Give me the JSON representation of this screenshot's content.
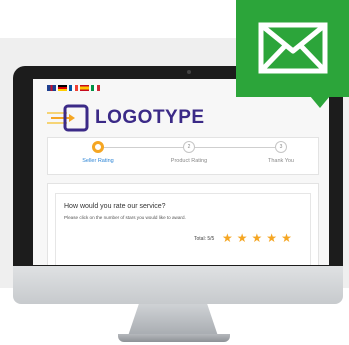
{
  "languages": [
    "en-flag",
    "de-flag",
    "fr-flag",
    "es-flag",
    "it-flag"
  ],
  "logo": {
    "text": "LOGOTYPE"
  },
  "steps": [
    {
      "label": "Seller Rating",
      "number": "",
      "active": true
    },
    {
      "label": "Product Rating",
      "number": "2",
      "active": false
    },
    {
      "label": "Thank You",
      "number": "3",
      "active": false
    }
  ],
  "rating": {
    "question": "How would you rate our service?",
    "hint": "Please click on the number of stars you would like to award.",
    "total_label": "Total: 5/5",
    "stars": 5
  },
  "colors": {
    "accent": "#2ca53a",
    "star": "#f5a623",
    "brand": "#3b2a87",
    "active_step": "#2f86d6"
  },
  "icons": {
    "mail": "envelope-icon"
  }
}
